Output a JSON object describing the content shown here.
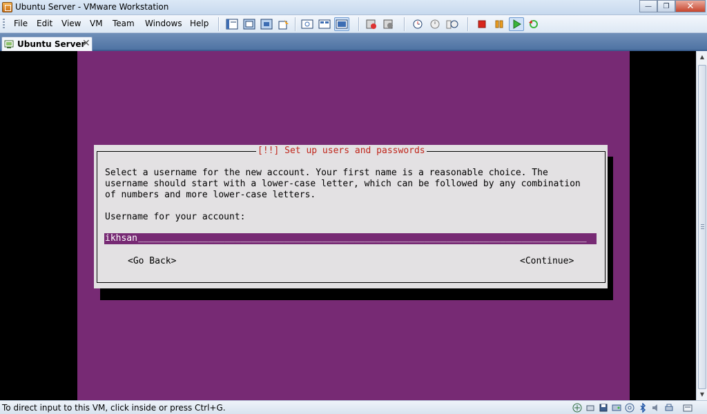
{
  "window": {
    "title": "Ubuntu Server - VMware Workstation",
    "minimize_label": "—",
    "restore_label": "❐",
    "close_label": "✕"
  },
  "menu": [
    "File",
    "Edit",
    "View",
    "VM",
    "Team",
    "Windows",
    "Help"
  ],
  "toolbar": {
    "icons": [
      "full-screen-icon",
      "quick-switch-icon",
      "unity-icon",
      "summary-icon",
      "console-view-icon",
      "thumbnail-icon",
      "active-view-icon",
      "snapshot-icon",
      "revert-snapshot-icon",
      "snapshot-manager-icon",
      "clone-icon",
      "clone-manager-icon",
      "power-off-icon",
      "suspend-icon",
      "power-on-icon",
      "reset-icon"
    ]
  },
  "tab": {
    "label": "Ubuntu Server",
    "close": "✕"
  },
  "installer": {
    "title": "[!!] Set up users and passwords",
    "text_lines": [
      "Select a username for the new account. Your first name is a reasonable choice. The",
      "username should start with a lower-case letter, which can be followed by any combination",
      "of numbers and more lower-case letters."
    ],
    "prompt": "Username for your account:",
    "username_value": "ikhsan",
    "go_back": "<Go Back>",
    "continue": "<Continue>"
  },
  "status": {
    "message": "To direct input to this VM, click inside or press Ctrl+G.",
    "icons": [
      "network-icon",
      "usb-icon",
      "floppy-icon",
      "hard-disk-icon",
      "cd-drive-icon",
      "bluetooth-icon",
      "sound-icon",
      "printer-icon",
      "message-log-icon"
    ]
  },
  "colors": {
    "console_purple": "#772a74",
    "dialog_bg": "#e3e1e3",
    "dialog_title": "#c0261b"
  }
}
